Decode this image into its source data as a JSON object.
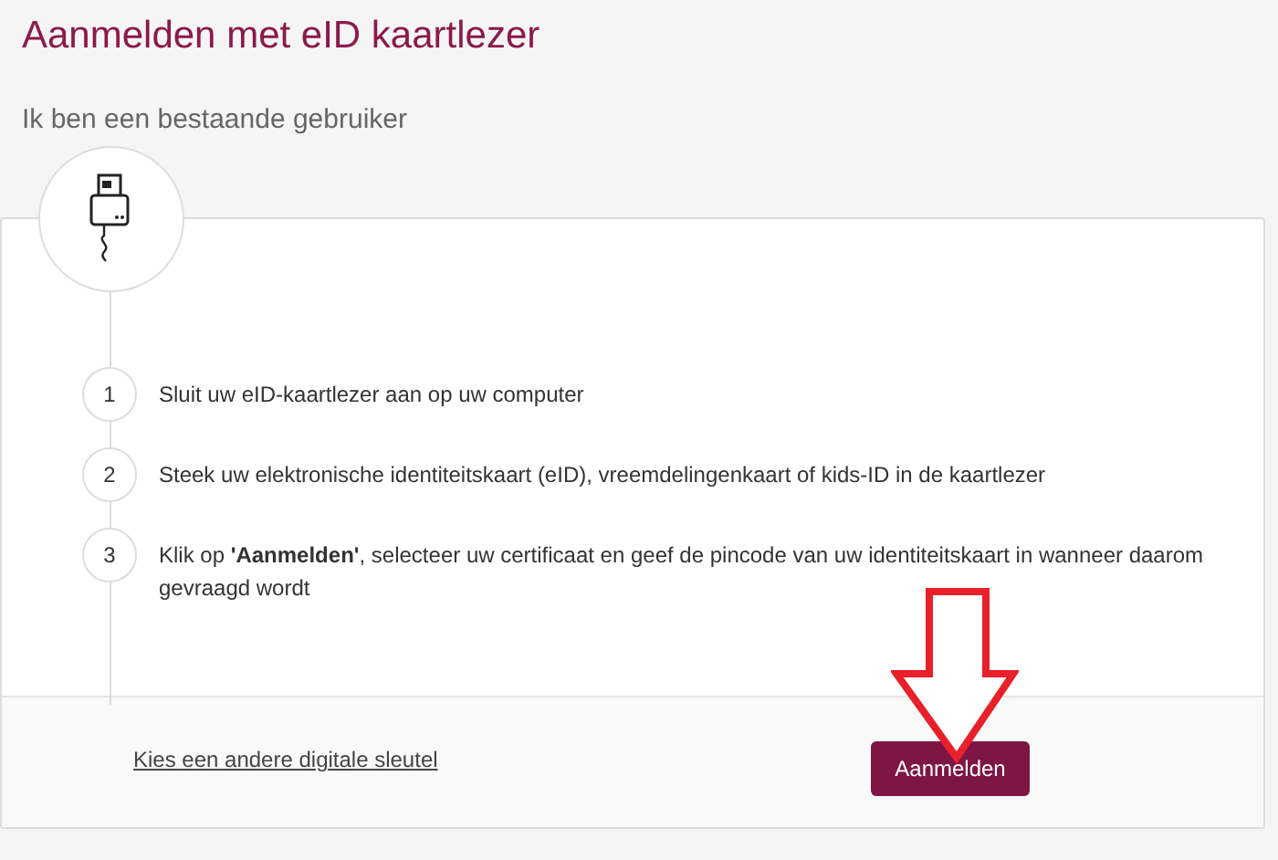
{
  "title": "Aanmelden met eID kaartlezer",
  "subtitle": "Ik ben een bestaande gebruiker",
  "steps": [
    {
      "number": "1",
      "text": "Sluit uw eID-kaartlezer aan op uw computer"
    },
    {
      "number": "2",
      "text": "Steek uw elektronische identiteitskaart (eID), vreemdelingenkaart of kids-ID in de kaartlezer"
    },
    {
      "number": "3",
      "text": "Klik op **'Aanmelden'**, selecteer uw certificaat en geef de pincode van uw identiteitskaart in wanneer daarom gevraagd wordt"
    }
  ],
  "footer": {
    "link": "Kies een andere digitale sleutel",
    "button": "Aanmelden"
  }
}
